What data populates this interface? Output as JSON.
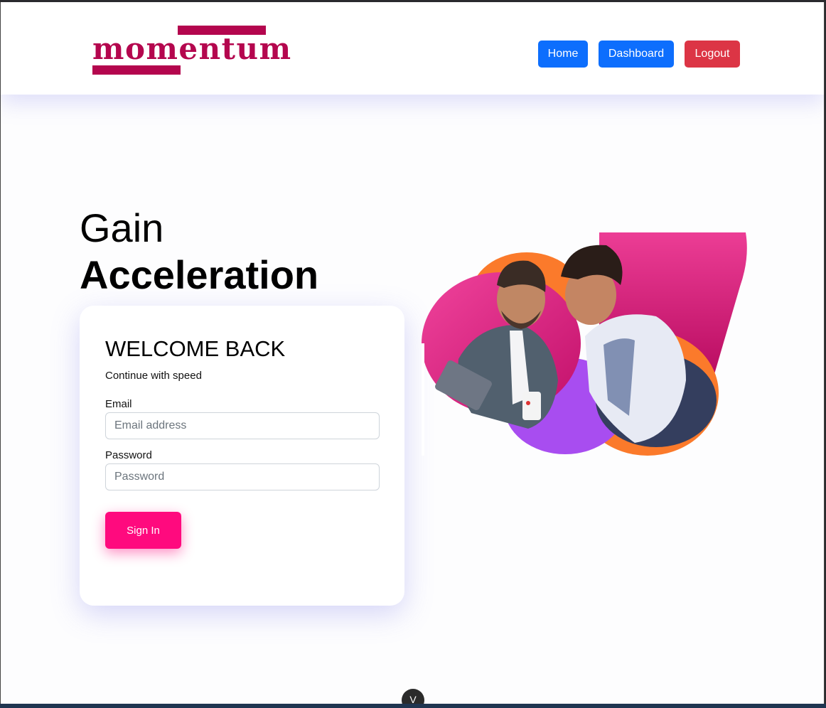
{
  "brand": {
    "logo_text": "momentum",
    "color": "#b4064e"
  },
  "nav": {
    "home_label": "Home",
    "dashboard_label": "Dashboard",
    "logout_label": "Logout",
    "primary_color": "#0d6efd",
    "danger_color": "#dc3545"
  },
  "hero": {
    "title_line1": "Gain",
    "title_line2": "Acceleration"
  },
  "login": {
    "title": "WELCOME BACK",
    "subtitle": "Continue with speed",
    "email_label": "Email",
    "email_placeholder": "Email address",
    "password_label": "Password",
    "password_placeholder": "Password",
    "submit_label": "Sign In",
    "submit_color": "#ff0a7e"
  },
  "scroll_chip": {
    "icon": "chevron-down-icon",
    "glyph": "V"
  }
}
